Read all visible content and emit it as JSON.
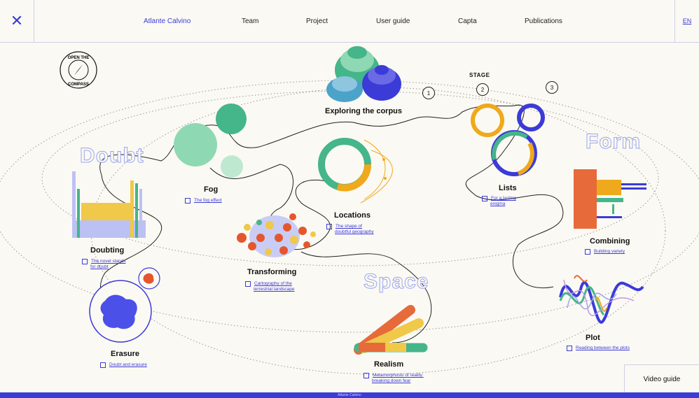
{
  "nav": {
    "close_icon": "close-icon",
    "links": [
      "Atlante Calvino",
      "Team",
      "Project",
      "User guide",
      "Capta",
      "Publications"
    ],
    "lang": "EN",
    "accent": "#3b3bd8"
  },
  "compass": {
    "text_top": "OPEN THE",
    "text_bottom": "COMPASS"
  },
  "stage": {
    "label": "STAGE",
    "numbers": [
      "1",
      "2",
      "3"
    ]
  },
  "areas": {
    "doubt": "Doubt",
    "form": "Form",
    "space": "Space"
  },
  "nodes": {
    "exploring": {
      "title": "Exploring the corpus"
    },
    "fog": {
      "title": "Fog",
      "sub": "The fog effect"
    },
    "locations": {
      "title": "Locations",
      "sub1": "The shape of",
      "sub2": "doubtful geography"
    },
    "lists": {
      "title": "Lists",
      "sub1": "For a lasting",
      "sub2": "enigma"
    },
    "doubting": {
      "title": "Doubting",
      "sub1": "The novel stands",
      "sub2": "for doubt"
    },
    "transforming": {
      "title": "Transforming",
      "sub1": "Cartography of the",
      "sub2": "terrestrial landscape"
    },
    "combining": {
      "title": "Combining",
      "sub": "Building variety"
    },
    "erasure": {
      "title": "Erasure",
      "sub": "Doubt and erasure"
    },
    "realism": {
      "title": "Realism",
      "sub1": "Metamorphosis of reality:",
      "sub2": "breaking down fear"
    },
    "plot": {
      "title": "Plot",
      "sub": "Reading between the plots"
    }
  },
  "video_guide": "Video guide",
  "footer": "Atlante Calvino"
}
